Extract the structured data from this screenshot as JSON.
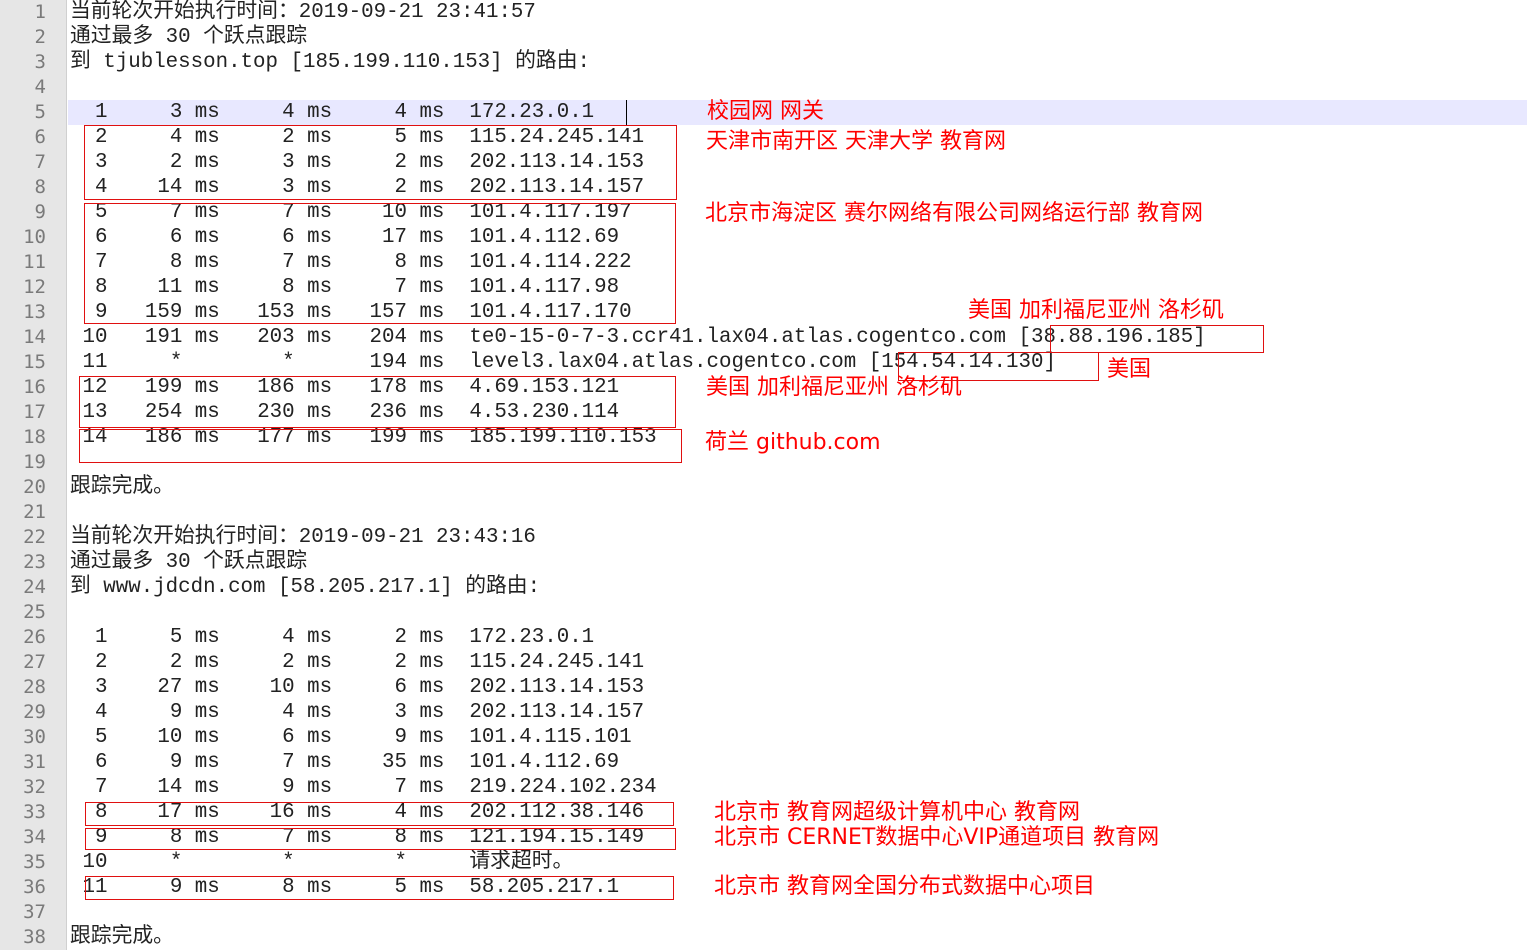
{
  "editor": {
    "line_numbers": [
      "1",
      "2",
      "3",
      "4",
      "5",
      "6",
      "7",
      "8",
      "9",
      "10",
      "11",
      "12",
      "13",
      "14",
      "15",
      "16",
      "17",
      "18",
      "19",
      "20",
      "21",
      "22",
      "23",
      "24",
      "25",
      "26",
      "27",
      "28",
      "29",
      "30",
      "31",
      "32",
      "33",
      "34",
      "35",
      "36",
      "37",
      "38"
    ],
    "current_line": 5,
    "lines": [
      "当前轮次开始执行时间：2019-09-21 23:41:57",
      "通过最多 30 个跃点跟踪",
      "到 tjublesson.top [185.199.110.153] 的路由:",
      "",
      "  1     3 ms     4 ms     4 ms  172.23.0.1",
      "  2     4 ms     2 ms     5 ms  115.24.245.141",
      "  3     2 ms     3 ms     2 ms  202.113.14.153",
      "  4    14 ms     3 ms     2 ms  202.113.14.157",
      "  5     7 ms     7 ms    10 ms  101.4.117.197",
      "  6     6 ms     6 ms    17 ms  101.4.112.69",
      "  7     8 ms     7 ms     8 ms  101.4.114.222",
      "  8    11 ms     8 ms     7 ms  101.4.117.98",
      "  9   159 ms   153 ms   157 ms  101.4.117.170",
      " 10   191 ms   203 ms   204 ms  te0-15-0-7-3.ccr41.lax04.atlas.cogentco.com [38.88.196.185]",
      " 11     *        *      194 ms  level3.lax04.atlas.cogentco.com [154.54.14.130]",
      " 12   199 ms   186 ms   178 ms  4.69.153.121",
      " 13   254 ms   230 ms   236 ms  4.53.230.114",
      " 14   186 ms   177 ms   199 ms  185.199.110.153",
      "",
      "跟踪完成。",
      "",
      "当前轮次开始执行时间：2019-09-21 23:43:16",
      "通过最多 30 个跃点跟踪",
      "到 www.jdcdn.com [58.205.217.1] 的路由:",
      "",
      "  1     5 ms     4 ms     2 ms  172.23.0.1",
      "  2     2 ms     2 ms     2 ms  115.24.245.141",
      "  3    27 ms    10 ms     6 ms  202.113.14.153",
      "  4     9 ms     4 ms     3 ms  202.113.14.157",
      "  5    10 ms     6 ms     9 ms  101.4.115.101",
      "  6     9 ms     7 ms    35 ms  101.4.112.69",
      "  7    14 ms     9 ms     7 ms  219.224.102.234",
      "  8    17 ms    16 ms     4 ms  202.112.38.146",
      "  9     8 ms     7 ms     8 ms  121.194.15.149",
      " 10     *        *        *     请求超时。",
      " 11     9 ms     8 ms     5 ms  58.205.217.1",
      "",
      "跟踪完成。"
    ]
  },
  "annotations": {
    "campus_gateway": "校园网 网关",
    "tianjin": "天津市南开区 天津大学 教育网",
    "beijing_cernet": "北京市海淀区 赛尔网络有限公司网络运行部 教育网",
    "us_la_1": "美国 加利福尼亚州 洛杉矶",
    "us": "美国",
    "us_la_2": "美国 加利福尼亚州 洛杉矶",
    "netherlands_github": "荷兰 github.com",
    "beijing_supercomputer": "北京市 教育网超级计算机中心 教育网",
    "beijing_vip": "北京市 CERNET数据中心VIP通道项目 教育网",
    "beijing_distributed": "北京市 教育网全国分布式数据中心项目"
  },
  "colors": {
    "annotation": "#ff0000",
    "gutter": "#e6e6e6",
    "current_line": "#e8e8ff"
  }
}
